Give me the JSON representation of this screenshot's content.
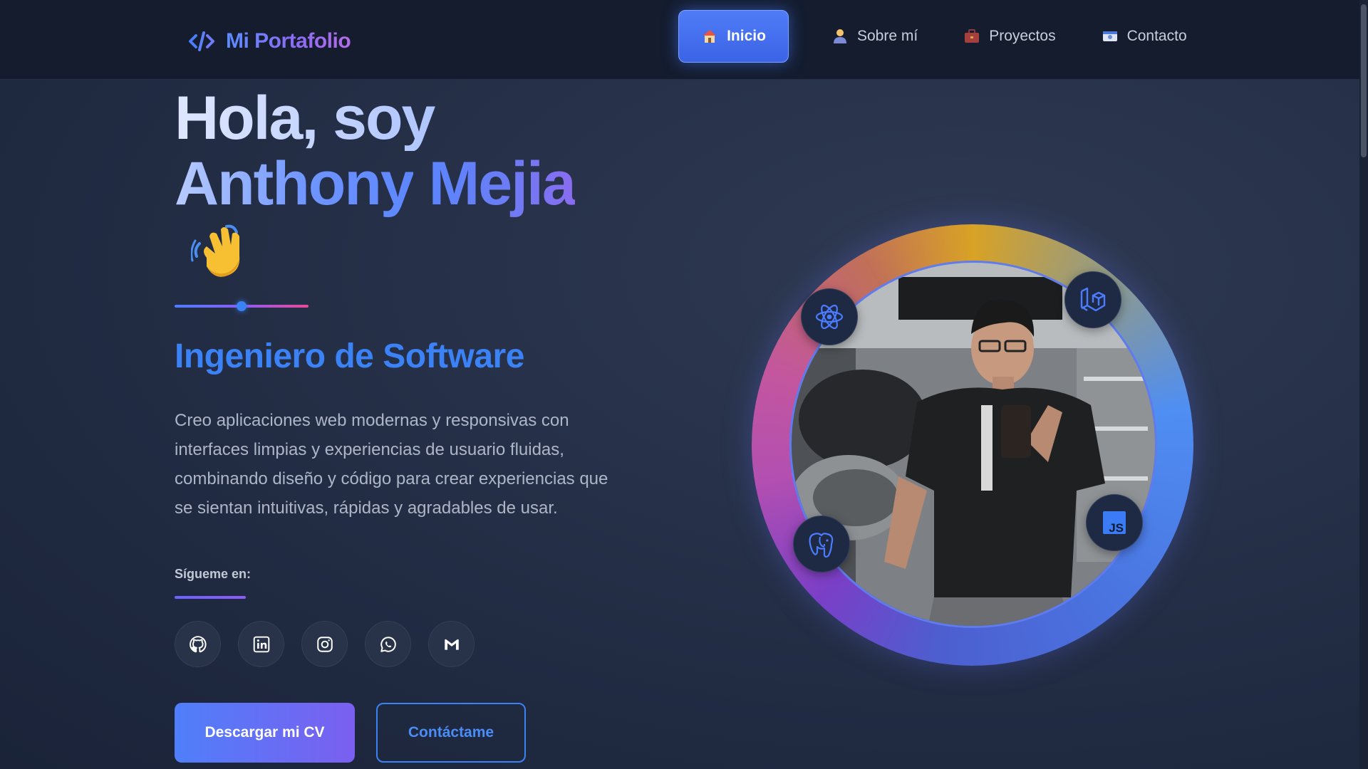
{
  "header": {
    "logo_text": "Mi Portafolio",
    "nav": [
      {
        "label": "Inicio",
        "icon": "house-icon",
        "active": true
      },
      {
        "label": "Sobre mí",
        "icon": "person-icon",
        "active": false
      },
      {
        "label": "Proyectos",
        "icon": "briefcase-icon",
        "active": false
      },
      {
        "label": "Contacto",
        "icon": "id-card-icon",
        "active": false
      }
    ]
  },
  "hero": {
    "greeting": "Hola, soy",
    "first_name": "Anthony",
    "last_name": "Mejia",
    "role": "Ingeniero de Software",
    "description": "Creo aplicaciones web modernas y responsivas con interfaces limpias y experiencias de usuario fluidas, combinando diseño y código para crear experiencias que se sientan intuitivas, rápidas y agradables de usar."
  },
  "social": {
    "heading": "Sígueme en:",
    "links": [
      "github-icon",
      "linkedin-icon",
      "instagram-icon",
      "whatsapp-icon",
      "gmail-icon"
    ]
  },
  "buttons": {
    "cv": "Descargar mi CV",
    "contact": "Contáctame"
  },
  "profile": {
    "badges": [
      "react-icon",
      "laravel-icon",
      "postgresql-icon",
      "javascript-icon"
    ],
    "js_badge_text": "JS"
  },
  "colors": {
    "accent": "#3b82f6",
    "background": "#1f2940",
    "header": "#141c2e"
  }
}
